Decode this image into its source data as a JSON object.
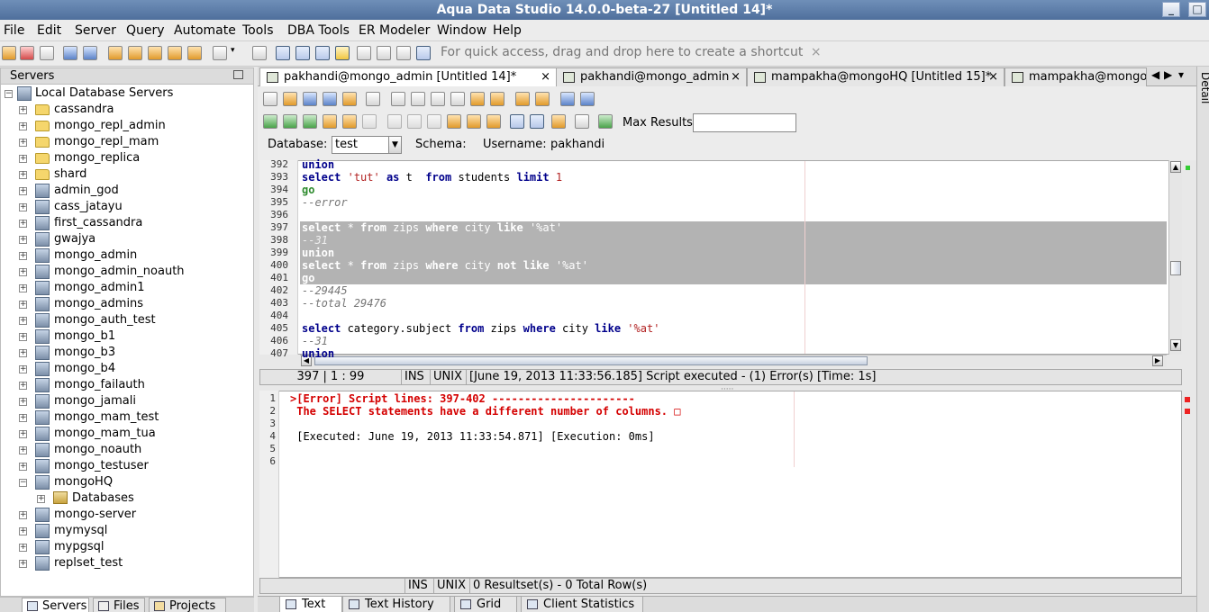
{
  "window": {
    "title": "Aqua Data Studio 14.0.0-beta-27 [Untitled 14]*"
  },
  "menu": [
    "File",
    "Edit",
    "Server",
    "Query",
    "Automate",
    "Tools",
    "DBA Tools",
    "ER Modeler",
    "Window",
    "Help"
  ],
  "toolbar": {
    "shortcut_hint": "For quick access, drag and drop here to create a shortcut"
  },
  "servers_panel": {
    "title": "Servers",
    "root": "Local Database Servers",
    "items": [
      {
        "label": "cassandra",
        "icon": "folder-icon"
      },
      {
        "label": "mongo_repl_admin",
        "icon": "folder-icon"
      },
      {
        "label": "mongo_repl_mam",
        "icon": "folder-icon"
      },
      {
        "label": "mongo_replica",
        "icon": "folder-icon"
      },
      {
        "label": "shard",
        "icon": "folder-icon"
      },
      {
        "label": "admin_god",
        "icon": "server-icon"
      },
      {
        "label": "cass_jatayu",
        "icon": "server-icon"
      },
      {
        "label": "first_cassandra",
        "icon": "server-icon"
      },
      {
        "label": "gwajya",
        "icon": "server-icon"
      },
      {
        "label": "mongo_admin",
        "icon": "server-icon"
      },
      {
        "label": "mongo_admin_noauth",
        "icon": "server-icon"
      },
      {
        "label": "mongo_admin1",
        "icon": "server-icon"
      },
      {
        "label": "mongo_admins",
        "icon": "server-icon"
      },
      {
        "label": "mongo_auth_test",
        "icon": "server-icon"
      },
      {
        "label": "mongo_b1",
        "icon": "server-icon"
      },
      {
        "label": "mongo_b3",
        "icon": "server-icon"
      },
      {
        "label": "mongo_b4",
        "icon": "server-icon"
      },
      {
        "label": "mongo_failauth",
        "icon": "server-icon"
      },
      {
        "label": "mongo_jamali",
        "icon": "server-icon"
      },
      {
        "label": "mongo_mam_test",
        "icon": "server-icon"
      },
      {
        "label": "mongo_mam_tua",
        "icon": "server-icon"
      },
      {
        "label": "mongo_noauth",
        "icon": "server-icon"
      },
      {
        "label": "mongo_testuser",
        "icon": "server-icon"
      },
      {
        "label": "mongoHQ",
        "icon": "server-icon",
        "expanded": true
      },
      {
        "label": "Databases",
        "icon": "db-icon",
        "child": true
      },
      {
        "label": "mongo-server",
        "icon": "server-icon"
      },
      {
        "label": "mymysql",
        "icon": "server-icon"
      },
      {
        "label": "mypgsql",
        "icon": "server-icon"
      },
      {
        "label": "replset_test",
        "icon": "server-icon"
      }
    ],
    "tabs": [
      "Servers",
      "Files",
      "Projects"
    ]
  },
  "editor_tabs": [
    "pakhandi@mongo_admin [Untitled 14]*",
    "pakhandi@mongo_admin",
    "mampakha@mongoHQ [Untitled 15]*",
    "mampakha@mongoHQ"
  ],
  "query_toolbar": {
    "max_results_label": "Max Results:",
    "max_results_value": "",
    "database_label": "Database:",
    "database_value": "test",
    "schema_label": "Schema:",
    "username_label": "Username:",
    "username_value": "pakhandi"
  },
  "code_lines": [
    {
      "n": "392",
      "text": "union"
    },
    {
      "n": "393",
      "text": "select 'tut' as t  from students limit 1"
    },
    {
      "n": "394",
      "text": "go"
    },
    {
      "n": "395",
      "text": "--error"
    },
    {
      "n": "396",
      "text": ""
    },
    {
      "n": "397",
      "text": "select * from zips where city like '%at'"
    },
    {
      "n": "398",
      "text": "--31"
    },
    {
      "n": "399",
      "text": "union"
    },
    {
      "n": "400",
      "text": "select * from zips where city not like '%at'"
    },
    {
      "n": "401",
      "text": "go"
    },
    {
      "n": "402",
      "text": "--29445"
    },
    {
      "n": "403",
      "text": "--total 29476"
    },
    {
      "n": "404",
      "text": ""
    },
    {
      "n": "405",
      "text": "select category.subject from zips where city like '%at'"
    },
    {
      "n": "406",
      "text": "--31"
    },
    {
      "n": "407",
      "text": "union"
    }
  ],
  "editor_status": {
    "position": "397 | 1 : 99",
    "mode": "INS",
    "line_ending": "UNIX",
    "message": "[June 19, 2013 11:33:56.185] Script executed - (1) Error(s) [Time: 1s]"
  },
  "output_lines": [
    {
      "n": "1",
      "text": ">[Error] Script lines: 397-402 ----------------------"
    },
    {
      "n": "2",
      "text": " The SELECT statements have a different number of columns. □"
    },
    {
      "n": "3",
      "text": ""
    },
    {
      "n": "4",
      "text": " [Executed: June 19, 2013 11:33:54.871] [Execution: 0ms]"
    },
    {
      "n": "5",
      "text": ""
    },
    {
      "n": "6",
      "text": ""
    }
  ],
  "output_status": {
    "mode": "INS",
    "line_ending": "UNIX",
    "message": "0 Resultset(s) - 0 Total Row(s)"
  },
  "result_tabs": [
    "Text",
    "Text History",
    "Grid",
    "Client Statistics"
  ],
  "right_strip": {
    "label": "Detail"
  }
}
